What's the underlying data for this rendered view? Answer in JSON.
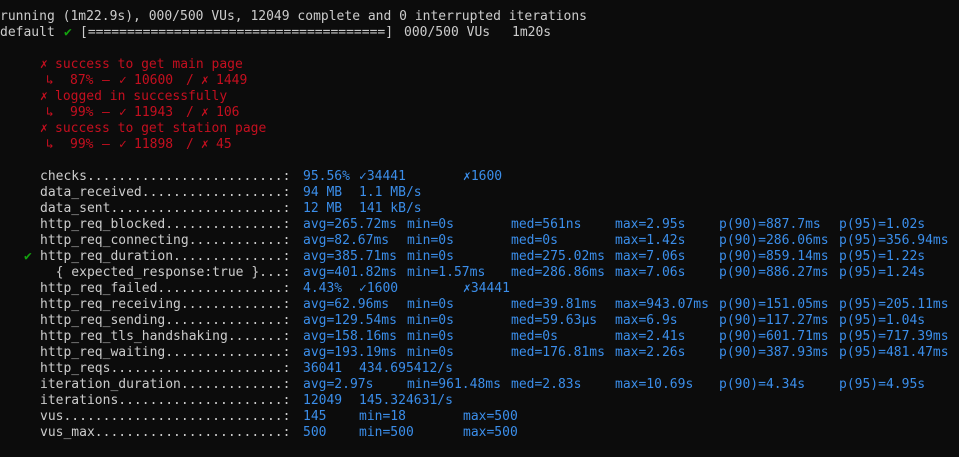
{
  "status": {
    "running_line": "running (1m22.9s), 000/500 VUs, 12049 complete and 0 interrupted iterations",
    "scenario_name": "default",
    "scenario_check": "✔",
    "progress_bar": "[======================================]",
    "progress_vus": "000/500 VUs",
    "progress_time": "1m20s"
  },
  "checks_detail": [
    {
      "mark": "✗",
      "name": "success to get main page",
      "arrow": "↳",
      "pct": "87%",
      "dash": "–",
      "pass_mark": "✓",
      "pass": "10600",
      "sep": "/",
      "fail_mark": "✗",
      "fail": "1449"
    },
    {
      "mark": "✗",
      "name": "logged in successfully",
      "arrow": "↳",
      "pct": "99%",
      "dash": "–",
      "pass_mark": "✓",
      "pass": "11943",
      "sep": "/",
      "fail_mark": "✗",
      "fail": "106"
    },
    {
      "mark": "✗",
      "name": "success to get station page",
      "arrow": "↳",
      "pct": "99%",
      "dash": "–",
      "pass_mark": "✓",
      "pass": "11898",
      "sep": "/",
      "fail_mark": "✗",
      "fail": "45"
    }
  ],
  "metrics": [
    {
      "flag": "",
      "label": "checks.........................:",
      "cells": [
        "95.56%",
        "✓34441",
        "✗1600"
      ]
    },
    {
      "flag": "",
      "label": "data_received..................:",
      "cells": [
        "94 MB",
        "1.1 MB/s"
      ]
    },
    {
      "flag": "",
      "label": "data_sent......................:",
      "cells": [
        "12 MB",
        "141 kB/s"
      ]
    },
    {
      "flag": "",
      "label": "http_req_blocked...............:",
      "cells": [
        "avg=265.72ms",
        "min=0s",
        "med=561ns",
        "max=2.95s",
        "p(90)=887.7ms",
        "p(95)=1.02s"
      ]
    },
    {
      "flag": "",
      "label": "http_req_connecting............:",
      "cells": [
        "avg=82.67ms",
        "min=0s",
        "med=0s",
        "max=1.42s",
        "p(90)=286.06ms",
        "p(95)=356.94ms"
      ]
    },
    {
      "flag": "✔",
      "label": "http_req_duration..............:",
      "cells": [
        "avg=385.71ms",
        "min=0s",
        "med=275.02ms",
        "max=7.06s",
        "p(90)=859.14ms",
        "p(95)=1.22s"
      ]
    },
    {
      "flag": "",
      "label": "  { expected_response:true }...:",
      "cells": [
        "avg=401.82ms",
        "min=1.57ms",
        "med=286.86ms",
        "max=7.06s",
        "p(90)=886.27ms",
        "p(95)=1.24s"
      ]
    },
    {
      "flag": "",
      "label": "http_req_failed................:",
      "cells": [
        "4.43%",
        "✓1600",
        "✗34441"
      ]
    },
    {
      "flag": "",
      "label": "http_req_receiving.............:",
      "cells": [
        "avg=62.96ms",
        "min=0s",
        "med=39.81ms",
        "max=943.07ms",
        "p(90)=151.05ms",
        "p(95)=205.11ms"
      ]
    },
    {
      "flag": "",
      "label": "http_req_sending...............:",
      "cells": [
        "avg=129.54ms",
        "min=0s",
        "med=59.63µs",
        "max=6.9s",
        "p(90)=117.27ms",
        "p(95)=1.04s"
      ]
    },
    {
      "flag": "",
      "label": "http_req_tls_handshaking.......:",
      "cells": [
        "avg=158.16ms",
        "min=0s",
        "med=0s",
        "max=2.41s",
        "p(90)=601.71ms",
        "p(95)=717.39ms"
      ]
    },
    {
      "flag": "",
      "label": "http_req_waiting...............:",
      "cells": [
        "avg=193.19ms",
        "min=0s",
        "med=176.81ms",
        "max=2.26s",
        "p(90)=387.93ms",
        "p(95)=481.47ms"
      ]
    },
    {
      "flag": "",
      "label": "http_reqs......................:",
      "cells": [
        "36041",
        "434.695412/s"
      ]
    },
    {
      "flag": "",
      "label": "iteration_duration.............:",
      "cells": [
        "avg=2.97s",
        "min=961.48ms",
        "med=2.83s",
        "max=10.69s",
        "p(90)=4.34s",
        "p(95)=4.95s"
      ]
    },
    {
      "flag": "",
      "label": "iterations.....................:",
      "cells": [
        "12049",
        "145.324631/s"
      ]
    },
    {
      "flag": "",
      "label": "vus............................:",
      "cells": [
        "145",
        "min=18",
        "max=500"
      ]
    },
    {
      "flag": "",
      "label": "vus_max........................:",
      "cells": [
        "500",
        "min=500",
        "max=500"
      ]
    }
  ],
  "colors": {
    "background": "#0c0c0c",
    "text": "#cccccc",
    "value": "#3b8eea",
    "fail": "#c50f1f",
    "pass": "#13a10e"
  }
}
